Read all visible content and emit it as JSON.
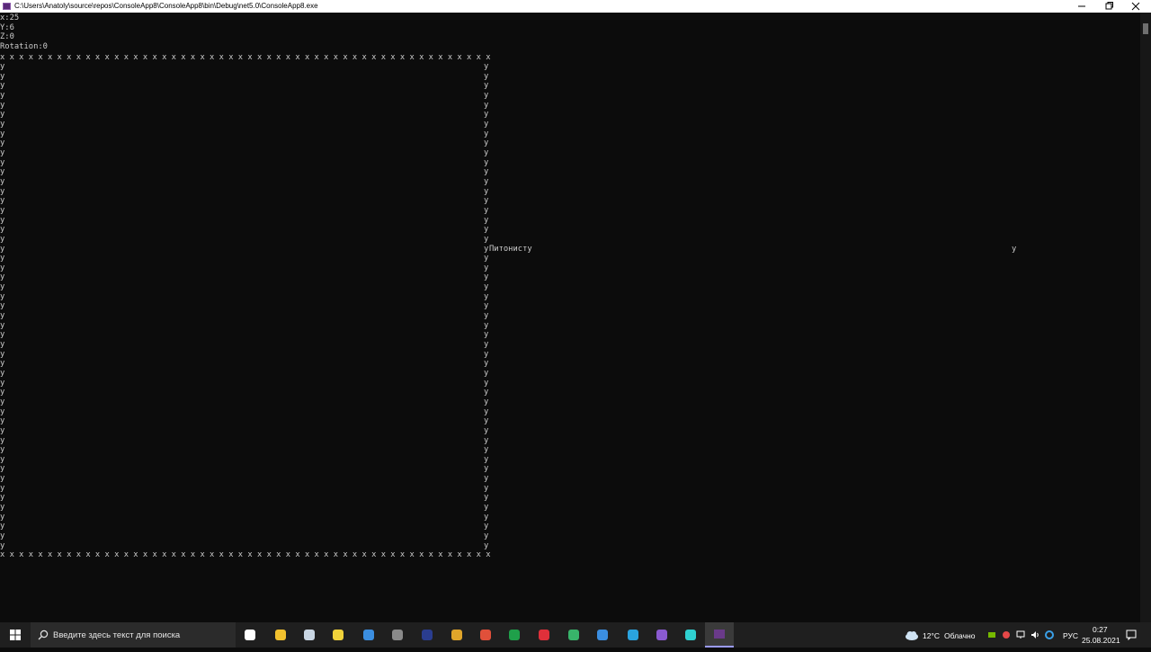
{
  "window": {
    "title": "C:\\Users\\Anatoly\\source\\repos\\ConsoleApp8\\ConsoleApp8\\bin\\Debug\\net5.0\\ConsoleApp8.exe"
  },
  "console": {
    "x_label": "x:25",
    "y_label": "Y:6",
    "z_label": "Z:0",
    "rotation_label": "Rotation:0",
    "border_char_h": "x",
    "border_char_v": "y",
    "side_rows": 51,
    "message_row_index": 19,
    "message": "Питонисту",
    "stray_char": "y"
  },
  "taskbar": {
    "search_placeholder": "Введите здесь текст для поиска",
    "pinned_icons": [
      "task-view-icon",
      "file-explorer-icon",
      "photos-icon",
      "sticky-app-icon",
      "mail-icon",
      "calculator-icon",
      "photoshop-icon",
      "chrome-icon",
      "paint-app-icon",
      "s-app-icon",
      "opera-icon",
      "green-app-icon",
      "blue-app-icon",
      "telegram-icon",
      "visual-studio-icon",
      "pen-app-icon",
      "console-app-icon"
    ],
    "weather_temp": "12°C",
    "weather_text": "Облачно",
    "language": "РУС",
    "time": "0:27",
    "date": "25.08.2021"
  }
}
